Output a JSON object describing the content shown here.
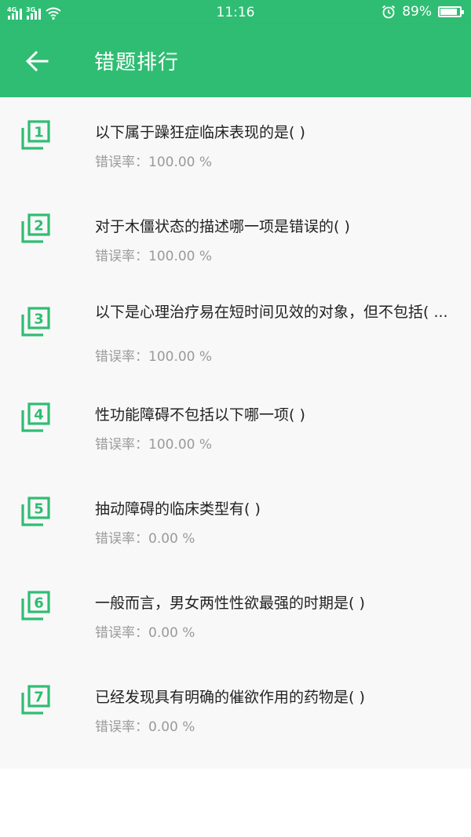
{
  "status_bar": {
    "network_1": "4G",
    "network_2": "3G",
    "time": "11:16",
    "battery_text": "89%",
    "battery_level": 0.89,
    "icons": [
      "signal-icon",
      "wifi-icon",
      "alarm-icon",
      "battery-icon"
    ]
  },
  "app_bar": {
    "title": "错题排行",
    "back_icon": "arrow-left-icon",
    "color": "#2fbd73"
  },
  "error_rate_label": "错误率：",
  "accent_color": "#2fbd73",
  "items": [
    {
      "rank": "1",
      "question": "以下属于躁狂症临床表现的是(    )",
      "rate": "100.00 %"
    },
    {
      "rank": "2",
      "question": "对于木僵状态的描述哪一项是错误的(    )",
      "rate": "100.00 %"
    },
    {
      "rank": "3",
      "question": "以下是心理治疗易在短时间见效的对象，但不包括( ...",
      "rate": "100.00 %"
    },
    {
      "rank": "4",
      "question": "性功能障碍不包括以下哪一项(    )",
      "rate": "100.00 %"
    },
    {
      "rank": "5",
      "question": "抽动障碍的临床类型有(    )",
      "rate": "0.00 %"
    },
    {
      "rank": "6",
      "question": "一般而言，男女两性性欲最强的时期是(    )",
      "rate": "0.00 %"
    },
    {
      "rank": "7",
      "question": "已经发现具有明确的催欲作用的药物是(    )",
      "rate": "0.00 %"
    }
  ]
}
